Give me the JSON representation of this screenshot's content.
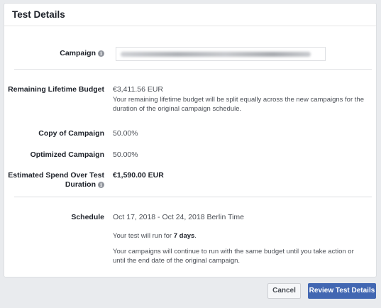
{
  "dialog": {
    "title": "Test Details"
  },
  "fields": {
    "campaign_label": "Campaign",
    "remaining_budget_label": "Remaining Lifetime Budget",
    "remaining_budget_value": "€3,411.56 EUR",
    "remaining_budget_note": "Your remaining lifetime budget will be split equally across the new campaigns for the duration of the original campaign schedule.",
    "copy_label": "Copy of Campaign",
    "copy_value": "50.00%",
    "optimized_label": "Optimized Campaign",
    "optimized_value": "50.00%",
    "spend_label_line1": "Estimated Spend Over Test",
    "spend_label_line2": "Duration",
    "spend_value": "€1,590.00 EUR",
    "schedule_label": "Schedule",
    "schedule_value": "Oct 17, 2018 - Oct 24, 2018 Berlin Time",
    "run_prefix": "Your test will run for ",
    "run_days": "7 days",
    "run_suffix": ".",
    "continue_note": "Your campaigns will continue to run with the same budget until you take action or until the end date of the original campaign."
  },
  "icons": {
    "info": "info-icon",
    "info_glyph": "i"
  },
  "buttons": {
    "cancel": "Cancel",
    "review": "Review Test Details"
  },
  "colors": {
    "primary": "#4267b2",
    "background": "#e9ebee"
  }
}
